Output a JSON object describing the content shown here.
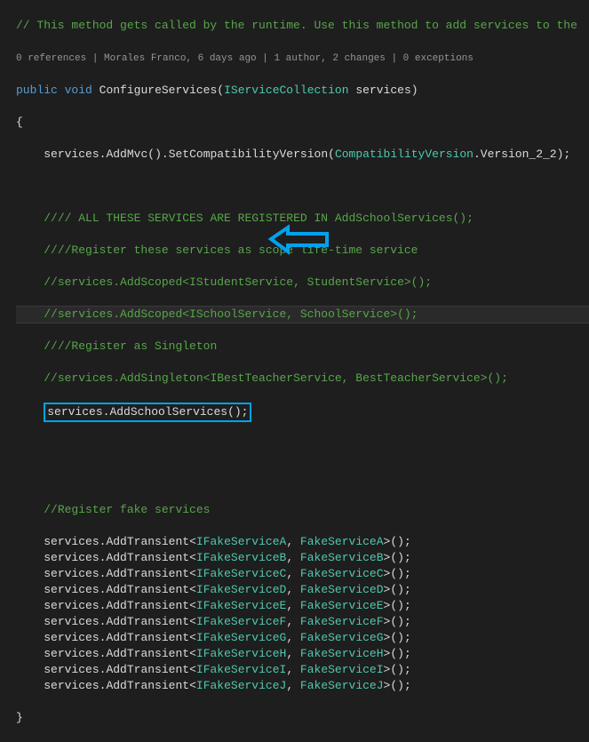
{
  "line1_comment": "// This method gets called by the runtime. Use this method to add services to the",
  "codelens": "0 references | Morales Franco, 6 days ago | 1 author, 2 changes | 0 exceptions",
  "kw_public": "public",
  "kw_void": "void",
  "method_name": "ConfigureServices",
  "param_type": "IServiceCollection",
  "param_name": "services",
  "open_brace": "{",
  "close_brace": "}",
  "svc": "services",
  "dot": ".",
  "addmvc": "AddMvc",
  "unit": "()",
  "setcompat": "SetCompatibilityVersion",
  "compatver": "CompatibilityVersion",
  "ver222": "Version_2_2",
  "end": ");",
  "c_block1": "//// ALL THESE SERVICES ARE REGISTERED IN AddSchoolServices();",
  "c_block2": "////Register these services as scope life-time service",
  "c_block3": "//services.AddScoped<IStudentService, StudentService>();",
  "c_block4": "//services.AddScoped<ISchoolService, SchoolService>();",
  "c_block5": "////Register as Singleton",
  "c_block6": "//services.AddSingleton<IBestTeacherService, BestTeacherService>();",
  "addschool": "AddSchoolServices",
  "end2": "();",
  "c_fake": "//Register fake services",
  "addtransient": "AddTransient",
  "lt": "<",
  "gt": ">",
  "comma": ", ",
  "fake": [
    {
      "i": "IFakeServiceA",
      "c": "FakeServiceA"
    },
    {
      "i": "IFakeServiceB",
      "c": "FakeServiceB"
    },
    {
      "i": "IFakeServiceC",
      "c": "FakeServiceC"
    },
    {
      "i": "IFakeServiceD",
      "c": "FakeServiceD"
    },
    {
      "i": "IFakeServiceE",
      "c": "FakeServiceE"
    },
    {
      "i": "IFakeServiceF",
      "c": "FakeServiceF"
    },
    {
      "i": "IFakeServiceG",
      "c": "FakeServiceG"
    },
    {
      "i": "IFakeServiceH",
      "c": "FakeServiceH"
    },
    {
      "i": "IFakeServiceI",
      "c": "FakeServiceI"
    },
    {
      "i": "IFakeServiceJ",
      "c": "FakeServiceJ"
    }
  ]
}
